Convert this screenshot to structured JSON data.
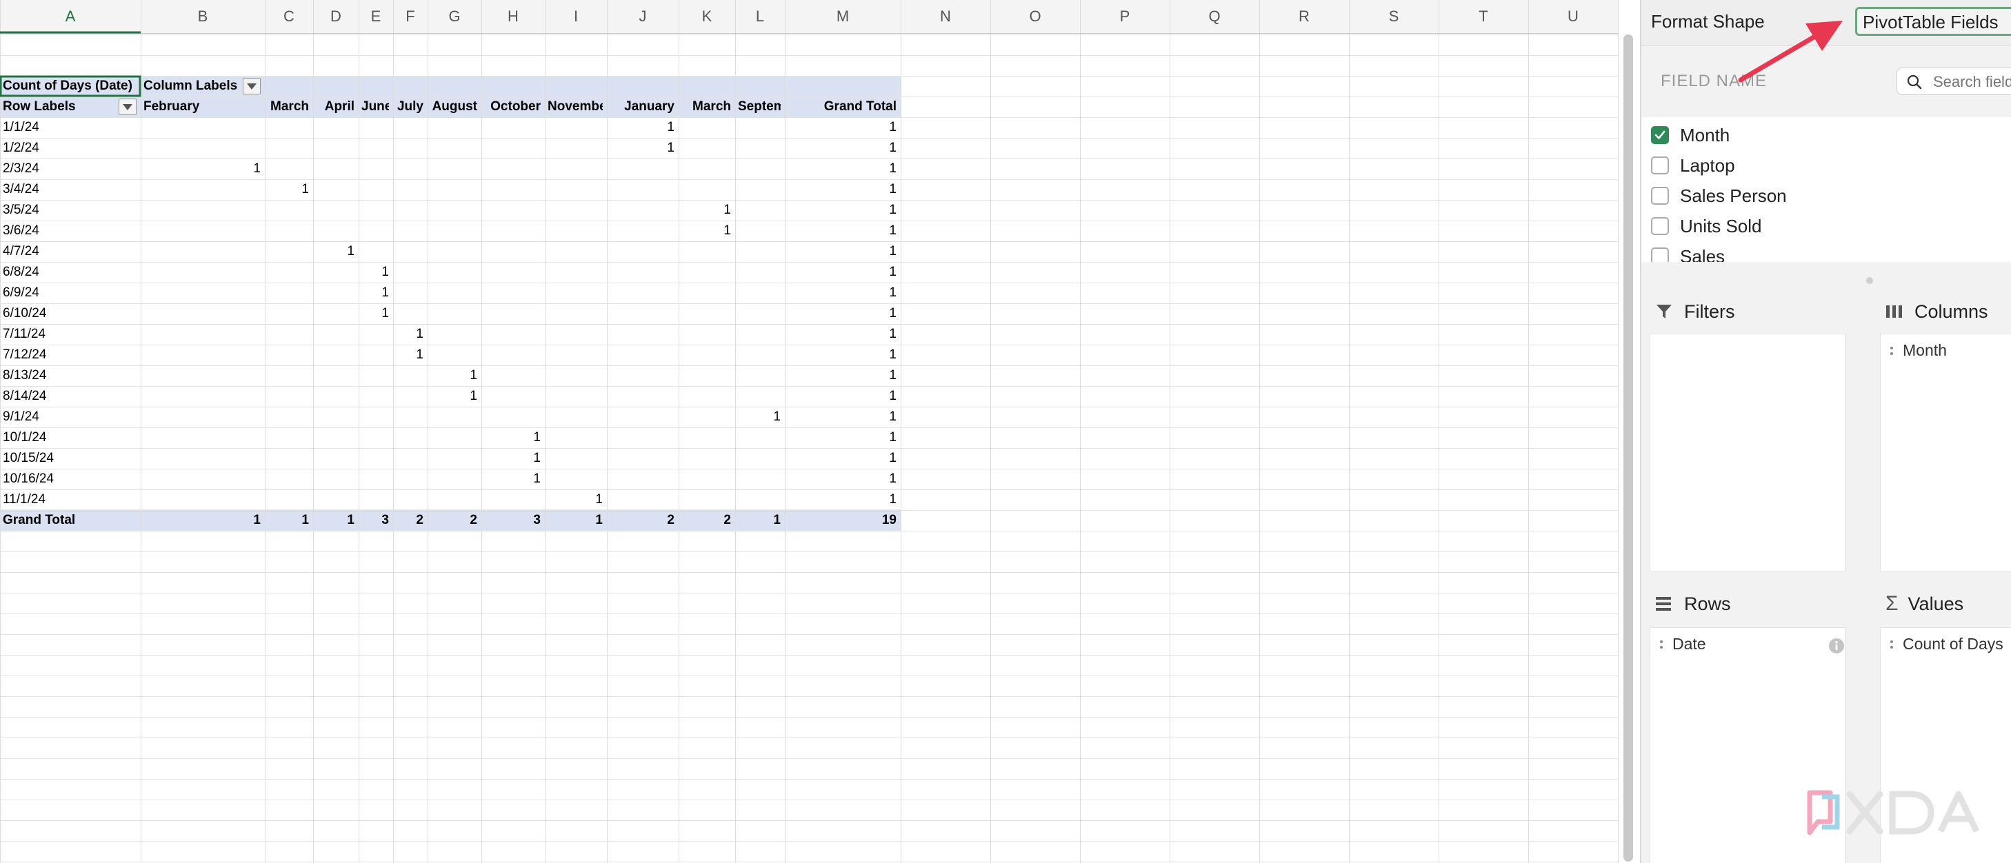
{
  "sheet": {
    "columns": [
      "A",
      "B",
      "C",
      "D",
      "E",
      "F",
      "G",
      "H",
      "I",
      "J",
      "K",
      "L",
      "M",
      "N",
      "O",
      "P",
      "Q",
      "R",
      "S",
      "T",
      "U"
    ],
    "active_column": "A",
    "pivot": {
      "value_field": "Count of Days (Date)",
      "column_labels": "Column Labels",
      "row_labels": "Row Labels",
      "months": [
        "February",
        "March",
        "April",
        "June",
        "July",
        "August",
        "October",
        "November",
        "January",
        "March",
        "September"
      ],
      "grand_total_label": "Grand Total",
      "rows": [
        {
          "label": "1/1/24",
          "col": 8,
          "value": "1",
          "total": "1"
        },
        {
          "label": "1/2/24",
          "col": 8,
          "value": "1",
          "total": "1"
        },
        {
          "label": "2/3/24",
          "col": 0,
          "value": "1",
          "total": "1"
        },
        {
          "label": "3/4/24",
          "col": 1,
          "value": "1",
          "total": "1"
        },
        {
          "label": "3/5/24",
          "col": 9,
          "value": "1",
          "total": "1"
        },
        {
          "label": "3/6/24",
          "col": 9,
          "value": "1",
          "total": "1"
        },
        {
          "label": "4/7/24",
          "col": 2,
          "value": "1",
          "total": "1"
        },
        {
          "label": "6/8/24",
          "col": 3,
          "value": "1",
          "total": "1"
        },
        {
          "label": "6/9/24",
          "col": 3,
          "value": "1",
          "total": "1"
        },
        {
          "label": "6/10/24",
          "col": 3,
          "value": "1",
          "total": "1"
        },
        {
          "label": "7/11/24",
          "col": 4,
          "value": "1",
          "total": "1"
        },
        {
          "label": "7/12/24",
          "col": 4,
          "value": "1",
          "total": "1"
        },
        {
          "label": "8/13/24",
          "col": 5,
          "value": "1",
          "total": "1"
        },
        {
          "label": "8/14/24",
          "col": 5,
          "value": "1",
          "total": "1"
        },
        {
          "label": "9/1/24",
          "col": 10,
          "value": "1",
          "total": "1"
        },
        {
          "label": "10/1/24",
          "col": 6,
          "value": "1",
          "total": "1"
        },
        {
          "label": "10/15/24",
          "col": 6,
          "value": "1",
          "total": "1"
        },
        {
          "label": "10/16/24",
          "col": 6,
          "value": "1",
          "total": "1"
        },
        {
          "label": "11/1/24",
          "col": 7,
          "value": "1",
          "total": "1"
        }
      ],
      "grand_totals": [
        "1",
        "1",
        "1",
        "3",
        "2",
        "2",
        "3",
        "1",
        "2",
        "2",
        "1"
      ],
      "grand_total_all": "19"
    }
  },
  "panel": {
    "tabs": {
      "format_shape": "Format Shape",
      "pivot_fields": "PivotTable Fields"
    },
    "field_name_label": "FIELD NAME",
    "search_placeholder": "Search fields",
    "fields": [
      {
        "label": "Month",
        "checked": true
      },
      {
        "label": "Laptop",
        "checked": false
      },
      {
        "label": "Sales Person",
        "checked": false
      },
      {
        "label": "Units Sold",
        "checked": false
      },
      {
        "label": "Sales",
        "checked": false
      }
    ],
    "areas": {
      "filters": {
        "title": "Filters"
      },
      "columns": {
        "title": "Columns",
        "item": "Month"
      },
      "rows": {
        "title": "Rows",
        "item": "Date"
      },
      "values": {
        "title": "Values",
        "item": "Count of Days"
      }
    }
  },
  "watermark": {
    "text": "XDA"
  },
  "colors": {
    "pivot_header": "#d9e1f2",
    "accent_green": "#217346",
    "arrow": "#e8384f",
    "check_green": "#2e8b57"
  }
}
